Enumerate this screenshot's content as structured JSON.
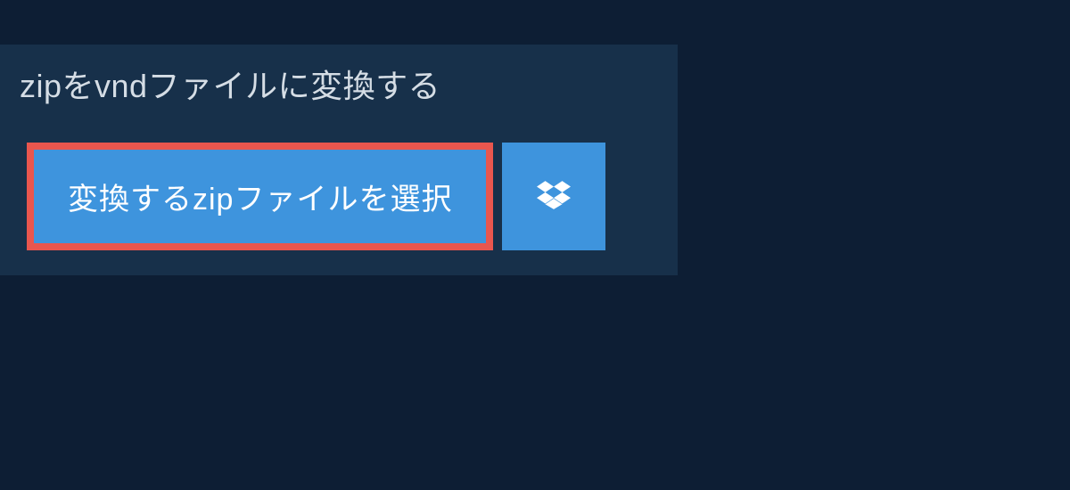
{
  "header": {
    "title": "zipをvndファイルに変換する"
  },
  "actions": {
    "select_file_label": "変換するzipファイルを選択"
  },
  "colors": {
    "background": "#0d1e34",
    "panel": "#17304a",
    "button_primary": "#3e94dd",
    "highlight_border": "#e9564e",
    "text_light": "#d5dde5",
    "text_white": "#ffffff"
  }
}
